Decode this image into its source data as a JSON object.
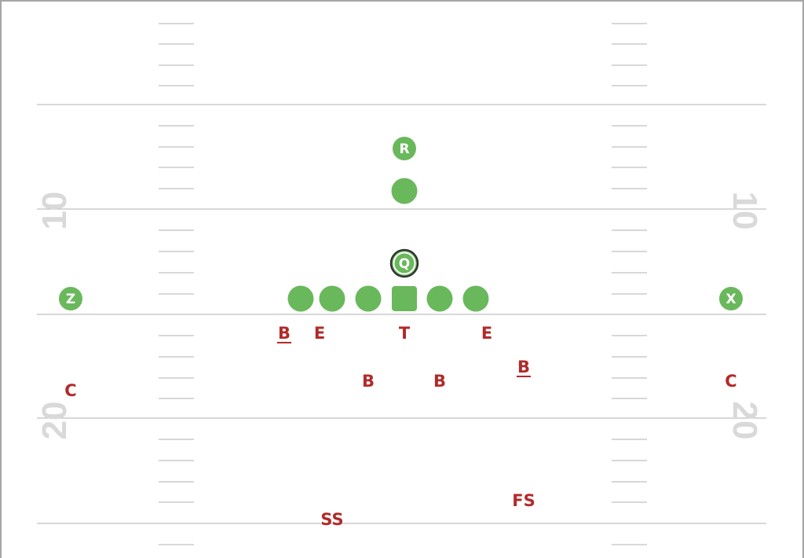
{
  "colors": {
    "offense": "#6ab85c",
    "defense": "#b22a2a",
    "field_line": "#b0b0b0",
    "hash_mark": "#b0b0b0",
    "yard_number": "#d9d9d9",
    "qb_ring": "#333333",
    "border": "#a6a6a6"
  },
  "field": {
    "yard_numbers": [
      "10",
      "10",
      "20",
      "20"
    ]
  },
  "offense": [
    {
      "id": "receiver-z",
      "label": "Z",
      "shape": "circle"
    },
    {
      "id": "lineman-1",
      "label": "",
      "shape": "circle"
    },
    {
      "id": "lineman-2",
      "label": "",
      "shape": "circle"
    },
    {
      "id": "lineman-3",
      "label": "",
      "shape": "circle"
    },
    {
      "id": "center",
      "label": "",
      "shape": "square"
    },
    {
      "id": "lineman-4",
      "label": "",
      "shape": "circle"
    },
    {
      "id": "lineman-5",
      "label": "",
      "shape": "circle"
    },
    {
      "id": "quarterback",
      "label": "Q",
      "shape": "circle-ring"
    },
    {
      "id": "fullback",
      "label": "",
      "shape": "circle"
    },
    {
      "id": "running-back",
      "label": "R",
      "shape": "circle"
    },
    {
      "id": "receiver-x",
      "label": "X",
      "shape": "circle"
    }
  ],
  "defense": [
    {
      "id": "linebacker-left",
      "label": "B",
      "underline": true
    },
    {
      "id": "end-left",
      "label": "E",
      "underline": false
    },
    {
      "id": "tackle",
      "label": "T",
      "underline": false
    },
    {
      "id": "end-right",
      "label": "E",
      "underline": false
    },
    {
      "id": "linebacker-inside-left",
      "label": "B",
      "underline": false
    },
    {
      "id": "linebacker-inside-right",
      "label": "B",
      "underline": false
    },
    {
      "id": "linebacker-right",
      "label": "B",
      "underline": true
    },
    {
      "id": "corner-left",
      "label": "C",
      "underline": false
    },
    {
      "id": "corner-right",
      "label": "C",
      "underline": false
    },
    {
      "id": "strong-safety",
      "label": "SS",
      "underline": false
    },
    {
      "id": "free-safety",
      "label": "FS",
      "underline": false
    }
  ]
}
